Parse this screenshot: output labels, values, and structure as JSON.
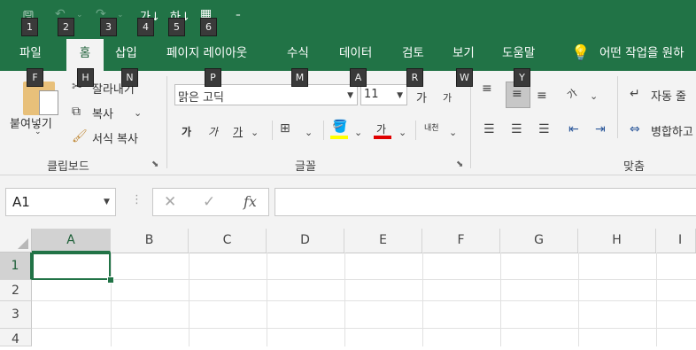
{
  "quick_access": {
    "keytips": [
      "1",
      "2",
      "3",
      "4",
      "5",
      "6"
    ],
    "customize_label": "⁼"
  },
  "tabs": [
    {
      "label": "파일",
      "keytip": "F"
    },
    {
      "label": "홈",
      "keytip": "H"
    },
    {
      "label": "삽입",
      "keytip": "N"
    },
    {
      "label": "페이지 레이아웃",
      "keytip": "P"
    },
    {
      "label": "수식",
      "keytip": "M"
    },
    {
      "label": "데이터",
      "keytip": "A"
    },
    {
      "label": "검토",
      "keytip": "R"
    },
    {
      "label": "보기",
      "keytip": "W"
    },
    {
      "label": "도움말",
      "keytip": "Y"
    }
  ],
  "tell_me": "어떤 작업을 원하",
  "clipboard": {
    "paste": "붙여넣기",
    "cut": "잘라내기",
    "copy": "복사",
    "format_painter": "서식 복사",
    "group_label": "클립보드"
  },
  "font": {
    "name": "맑은 고딕",
    "size": "11",
    "increase": "가",
    "decrease": "가",
    "bold": "가",
    "italic": "가",
    "underline": "가",
    "font_color": "가",
    "phonetic": "내천",
    "group_label": "글꼴",
    "highlight_color": "#ffff00",
    "font_color_value": "#e00000"
  },
  "alignment": {
    "orientation": "가",
    "wrap": "자동 줄",
    "merge": "병합하고",
    "group_label": "맞춤"
  },
  "formula_bar": {
    "name_box": "A1",
    "cancel": "✕",
    "enter": "✓",
    "fx": "fx",
    "formula": ""
  },
  "grid": {
    "columns": [
      "A",
      "B",
      "C",
      "D",
      "E",
      "F",
      "G",
      "H",
      "I"
    ],
    "rows": [
      "1",
      "2",
      "3",
      "4"
    ],
    "active_cell": "A1"
  }
}
